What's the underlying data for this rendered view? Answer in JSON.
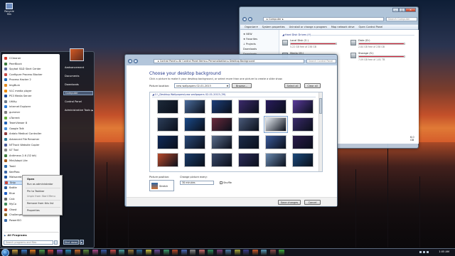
{
  "desktop": {
    "icons": [
      {
        "label": "Recycle Bin",
        "icon": "recycle-bin-icon"
      }
    ]
  },
  "start_menu": {
    "programs": [
      {
        "label": "CCleaner",
        "color": "#d33a2c"
      },
      {
        "label": "PeerBlock",
        "color": "#3b7a3b"
      },
      {
        "label": "Spybot S&D Start Center",
        "color": "#5b6b9c"
      },
      {
        "label": "Configure Process Blocker",
        "color": "#c44a44"
      },
      {
        "label": "Process Hacker 2",
        "color": "#1f6bb8"
      },
      {
        "label": "ImgBurn",
        "color": "#e38a1f"
      },
      {
        "label": "VLC media player",
        "color": "#f08a00"
      },
      {
        "label": "PS3 Media Server",
        "color": "#1d4c9e"
      },
      {
        "label": "Utility",
        "color": "#6e7b8a"
      },
      {
        "label": "Internet Explorer",
        "color": "#2c7bd6"
      },
      {
        "label": "gummer",
        "color": "#7f7f7f"
      },
      {
        "label": "uTorrent",
        "color": "#64b13a"
      },
      {
        "label": "TeamViewer 8",
        "color": "#1f62b8"
      },
      {
        "label": "Google Talk",
        "color": "#4a90d9"
      },
      {
        "label": "Ardalo Medical Controller",
        "color": "#8c3b3b"
      },
      {
        "label": "Advanced File Renamer",
        "color": "#2e7d9a"
      },
      {
        "label": "NTTrack Website Copier",
        "color": "#4b5c99"
      },
      {
        "label": "ILT Tool",
        "color": "#888888"
      },
      {
        "label": "Antimeus 2.6 (32 bit)",
        "color": "#3c7a3c"
      },
      {
        "label": "MiniAdapt Lite",
        "color": "#a45a1c"
      },
      {
        "label": "Taskl",
        "color": "#2d6db0"
      },
      {
        "label": "KeePass",
        "color": "#3a66a6"
      },
      {
        "label": "Malwarebytes Anti-Malware",
        "color": "#1c54a3"
      },
      {
        "label": "Snip",
        "color": "#c8443a"
      },
      {
        "label": "Battle",
        "color": "#2c5f9e"
      },
      {
        "label": "Blue",
        "color": "#1f5ec4"
      },
      {
        "label": "Calc",
        "color": "#6c6c6c"
      },
      {
        "label": "MyCo",
        "color": "#3f8a58"
      },
      {
        "label": "Ghost",
        "color": "#b84a2a"
      },
      {
        "label": "Challenger Ultimate",
        "color": "#8a6a2a"
      },
      {
        "label": "PowerISO",
        "color": "#3a6aa8"
      }
    ],
    "highlighted_index": 23,
    "all_programs": "All Programs",
    "search_placeholder": "Search programs and files",
    "right_items": [
      {
        "label": "Aadvancement",
        "arrow": false
      },
      {
        "label": "Documents",
        "arrow": false
      },
      {
        "label": "Downloads",
        "arrow": false
      },
      {
        "label": "Computer",
        "arrow": false
      },
      {
        "label": "Control Panel",
        "arrow": false
      },
      {
        "label": "Administrative Tools",
        "arrow": true
      }
    ],
    "right_highlighted_index": 3,
    "shutdown": "Shut down",
    "shutdown_arrow": "▶"
  },
  "context_menu": {
    "items": [
      {
        "label": "Open",
        "style": "bold"
      },
      {
        "label": "Run as administrator",
        "style": "normal"
      },
      {
        "label": "Pin to Taskbar",
        "style": "normal"
      },
      {
        "label": "Unpin from Start Menu",
        "style": "dim"
      },
      {
        "label": "Remove from this list",
        "style": "normal"
      },
      {
        "label": "Properties",
        "style": "normal"
      }
    ]
  },
  "computer_window": {
    "address": "▸ Computer ▸",
    "search_placeholder": "Search Computer",
    "toolbar": [
      "Organize ▾",
      "System properties",
      "Uninstall or change a program",
      "Map network drive",
      "Open Control Panel"
    ],
    "nav": [
      "★ NEW",
      "★ Favorites",
      "↓ Projects",
      "Downloads",
      "Downloads",
      "Desktop"
    ],
    "group_header": "◢ Hard Disk Drives (4)",
    "drives": [
      {
        "name": "Local Disk (C:)",
        "free": "5.22 GB free of 238 GB",
        "used_fraction": 0.98
      },
      {
        "name": "Data (D:)",
        "free": "2.84 GB free of 238 GB",
        "used_fraction": 0.99
      },
      {
        "name": "Media (M:)",
        "free": "",
        "used_fraction": 0.97
      },
      {
        "name": "Storage (S:)",
        "free": "7.09 GB free of 1.81 TB",
        "used_fraction": 0.99
      }
    ],
    "status": "6.0 GB",
    "title_buttons": {
      "minimize": "–",
      "maximize": "□",
      "close": "✕"
    }
  },
  "bg_window": {
    "address": "▸ Control Panel ▸ All Control Panel Items ▸ Personalization ▸ Desktop Background",
    "search_placeholder": "Search Control Panel",
    "title": "Choose your desktop background",
    "subtitle": "Click a picture to make it your desktop background, or select more than one picture to create a slide show.",
    "location_label": "Picture location:",
    "location_value": "new wallpapers 02-01-2013",
    "browse": "Browse...",
    "select_all": "Select all",
    "clear_all": "Clear all",
    "folder_header": "◢ C:\\_Desktop Wallpapers\\new wallpapers 02-01-2013 (39)",
    "thumb_colors": [
      [
        "#1d2a3a",
        "#4a6c9c",
        "#1c3e7a",
        "#3c2a6c",
        "#2a1c5e",
        "#5a3a9c"
      ],
      [
        "#2c3e5a",
        "#1a4a8a",
        "#6a2a3c",
        "#4a5a7a",
        "#e8eef5",
        "#3a2a6a"
      ],
      [
        "#0f2a5a",
        "#2a4a7a",
        "#5a6c8a",
        "#1c2c4a",
        "#3a5a9a",
        "#2a1a4a"
      ],
      [
        "#b84a2c",
        "#1a3c6a",
        "#3a4a6a",
        "#2c2c5a",
        "#6a8ab0",
        "#1c4a7c"
      ]
    ],
    "selected_thumb": [
      1,
      4
    ],
    "position_label": "Picture position:",
    "position_value": "Stretch",
    "time_label": "Change picture every:",
    "time_value": "30 minutes",
    "shuffle_label": "Shuffle",
    "save": "Save changes",
    "cancel": "Cancel"
  },
  "taskbar": {
    "clock": "1:05 AM",
    "app_colors": [
      "#c8a040",
      "#3a7ac8",
      "#e07a20",
      "#4a9a4a",
      "#d04040",
      "#7a5ac8",
      "#2a8ab8",
      "#c86a2a",
      "#5a8a3a",
      "#a84a8a",
      "#3a5aa8",
      "#c84a4a",
      "#4aa0a0",
      "#9a7a3a",
      "#2a6a9a",
      "#c8c040",
      "#6a4a9a",
      "#3a9a6a",
      "#b84a2a",
      "#4a6ab8",
      "#8a8a8a",
      "#c86a6a",
      "#2a8a5a",
      "#7a3a7a",
      "#4a7aa8",
      "#a8a83a",
      "#3a3a8a",
      "#c85a2a",
      "#5a9ab8",
      "#8a4a4a",
      "#3aa83a"
    ]
  }
}
